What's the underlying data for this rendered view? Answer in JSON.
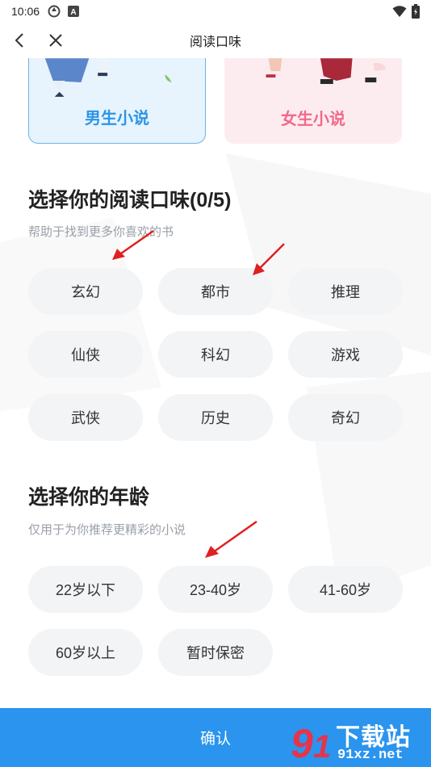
{
  "status_bar": {
    "time": "10:06",
    "icons": [
      "sync-icon",
      "a-badge-icon"
    ],
    "right_icons": [
      "wifi-icon",
      "battery-icon"
    ]
  },
  "nav": {
    "title": "阅读口味",
    "back_icon": "chevron-left-icon",
    "close_icon": "close-icon"
  },
  "gender": {
    "male_label": "男生小说",
    "female_label": "女生小说",
    "selected": "male"
  },
  "taste": {
    "title": "选择你的阅读口味(0/5)",
    "subtitle": "帮助于找到更多你喜欢的书",
    "options": [
      "玄幻",
      "都市",
      "推理",
      "仙侠",
      "科幻",
      "游戏",
      "武侠",
      "历史",
      "奇幻"
    ]
  },
  "age": {
    "title": "选择你的年龄",
    "subtitle": "仅用于为你推荐更精彩的小说",
    "options": [
      "22岁以下",
      "23-40岁",
      "41-60岁",
      "60岁以上",
      "暂时保密"
    ]
  },
  "confirm": {
    "label": "确认"
  },
  "watermark": {
    "line1": "下载站",
    "line2": "91xz.net"
  },
  "colors": {
    "accent": "#2a94ee",
    "male": "#2b95e9",
    "female": "#f06a8a",
    "chip_bg": "#f3f4f6",
    "arrow": "#e02020"
  }
}
